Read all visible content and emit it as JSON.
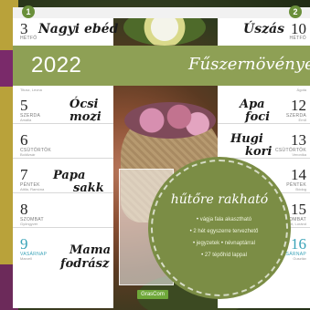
{
  "markers": {
    "left": "1",
    "right": "2"
  },
  "banner": {
    "year": "2022",
    "title": "Fűszernövények"
  },
  "header": {
    "left": {
      "day": "3",
      "dayname": "hétfő",
      "note": "Nagyi ebéd"
    },
    "right": {
      "day": "10",
      "dayname": "hétfő",
      "note": "Úszás"
    }
  },
  "left_days": [
    {
      "day": "5",
      "dayname": "szerda",
      "sub": "Amália",
      "note_line1": "Ócsi",
      "note_line2": "mozi"
    },
    {
      "day": "6",
      "dayname": "csütörtök",
      "sub": "Boldizsár",
      "note_line1": "",
      "note_line2": ""
    },
    {
      "day": "7",
      "dayname": "péntek",
      "sub": "Attila, Ramóna",
      "note_line1": "Papa",
      "note_line2": "sakk"
    },
    {
      "day": "8",
      "dayname": "szombat",
      "sub": "Gyöngyvér",
      "note_line1": "",
      "note_line2": ""
    },
    {
      "day": "9",
      "dayname": "vasárnap",
      "sub": "Marcell",
      "note_line1": "Mama",
      "note_line2": "fodrász"
    }
  ],
  "left_topnote": "Titusz, Leona",
  "right_days": [
    {
      "day": "12",
      "dayname": "szerda",
      "sub": "Ernő",
      "note_line1": "Apa",
      "note_line2": "foci"
    },
    {
      "day": "13",
      "dayname": "csütörtök",
      "sub": "Veronika",
      "note_line1": "Hugi",
      "note_line2": "kori"
    },
    {
      "day": "14",
      "dayname": "péntek",
      "sub": "Bódog",
      "note_line1": "",
      "note_line2": ""
    },
    {
      "day": "15",
      "dayname": "szombat",
      "sub": "Lóránt, Loránd",
      "note_line1": "",
      "note_line2": ""
    },
    {
      "day": "16",
      "dayname": "vasárnap",
      "sub": "Gusztáv",
      "note_line1": "",
      "note_line2": ""
    }
  ],
  "right_topnote": "Ágota",
  "badge": {
    "title": "hűtőre rakható",
    "items": [
      "vágja fala akasztható",
      "2 hét egyszerre tervezhető",
      "jegyzetek",
      "névnaptárral",
      "27 tépőhíd lappal"
    ]
  },
  "logo": "GrasCom"
}
